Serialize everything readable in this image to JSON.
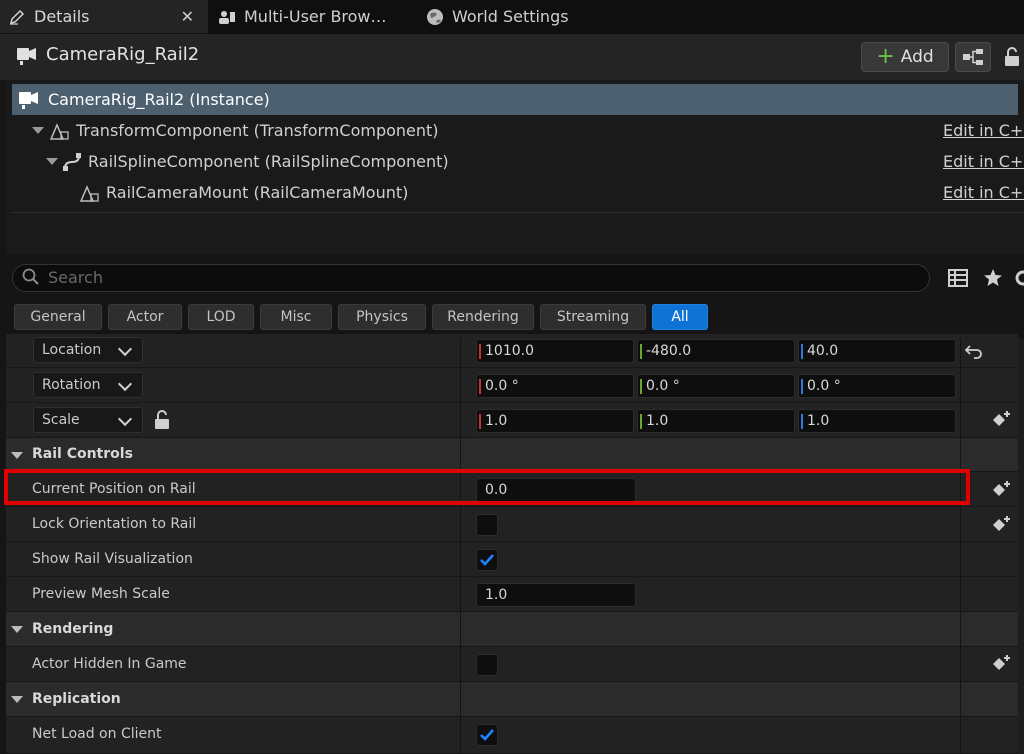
{
  "tabs": [
    {
      "label": "Details",
      "icon": "pencil-icon",
      "close": "✕"
    },
    {
      "label": "Multi-User Brow…",
      "icon": "users-icon"
    },
    {
      "label": "World Settings",
      "icon": "globe-icon"
    }
  ],
  "header": {
    "actor_name": "CameraRig_Rail2",
    "add_label": "Add"
  },
  "tree": {
    "root": "CameraRig_Rail2 (Instance)",
    "items": [
      {
        "label": "TransformComponent (TransformComponent)",
        "edit": "Edit in C++"
      },
      {
        "label": "RailSplineComponent (RailSplineComponent)",
        "edit": "Edit in C++"
      },
      {
        "label": "RailCameraMount (RailCameraMount)",
        "edit": "Edit in C++"
      }
    ]
  },
  "search": {
    "placeholder": "Search"
  },
  "filters": [
    "General",
    "Actor",
    "LOD",
    "Misc",
    "Physics",
    "Rendering",
    "Streaming",
    "All"
  ],
  "active_filter": "All",
  "transform": {
    "location": {
      "label": "Location",
      "x": "1010.0",
      "y": "-480.0",
      "z": "40.0"
    },
    "rotation": {
      "label": "Rotation",
      "x": "0.0 °",
      "y": "0.0 °",
      "z": "0.0 °"
    },
    "scale": {
      "label": "Scale",
      "x": "1.0",
      "y": "1.0",
      "z": "1.0"
    }
  },
  "categories": {
    "rail_controls": "Rail Controls",
    "rendering": "Rendering",
    "replication": "Replication"
  },
  "props": {
    "current_position": {
      "label": "Current Position on Rail",
      "value": "0.0"
    },
    "lock_orientation": {
      "label": "Lock Orientation to Rail",
      "checked": false
    },
    "show_rail": {
      "label": "Show Rail Visualization",
      "checked": true
    },
    "preview_scale": {
      "label": "Preview Mesh Scale",
      "value": "1.0"
    },
    "actor_hidden": {
      "label": "Actor Hidden In Game",
      "checked": false
    },
    "net_load": {
      "label": "Net Load on Client",
      "checked": true
    }
  },
  "colors": {
    "x_axis": "#c83232",
    "y_axis": "#6aa82a",
    "z_axis": "#2f78d8",
    "accent": "#0f73d6",
    "selection": "#4d6070",
    "highlight": "#e00000"
  }
}
